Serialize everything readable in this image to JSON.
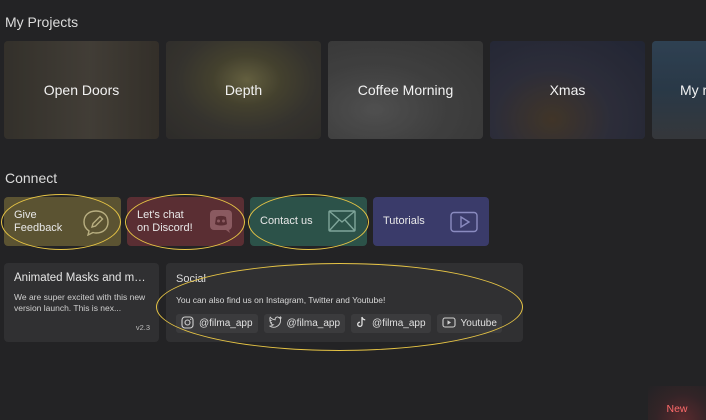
{
  "projects_section": {
    "title": "My Projects",
    "items": [
      {
        "label": "Open Doors"
      },
      {
        "label": "Depth"
      },
      {
        "label": "Coffee Morning"
      },
      {
        "label": "Xmas"
      },
      {
        "label": "My r"
      }
    ]
  },
  "connect_section": {
    "title": "Connect",
    "buttons": [
      {
        "label": "Give\nFeedback",
        "icon": "feedback-pencil-icon",
        "color": "#5b5332"
      },
      {
        "label": "Let's chat\non Discord!",
        "icon": "discord-icon",
        "color": "#5a2e33"
      },
      {
        "label": "Contact us",
        "icon": "mail-icon",
        "color": "#2c5249"
      },
      {
        "label": "Tutorials",
        "icon": "play-icon",
        "color": "#3a3b6a"
      }
    ]
  },
  "news_card": {
    "title": "Animated Masks and muc...",
    "body": "We are super excited with this new version launch. This is nex...",
    "version": "v2.3"
  },
  "social_card": {
    "title": "Social",
    "body": "You can also find us on Instagram, Twitter and Youtube!",
    "links": [
      {
        "icon": "instagram-icon",
        "label": "@filma_app"
      },
      {
        "icon": "twitter-icon",
        "label": "@filma_app"
      },
      {
        "icon": "tiktok-icon",
        "label": "@filma_app"
      },
      {
        "icon": "youtube-icon",
        "label": "Youtube"
      }
    ]
  },
  "badge": {
    "label": "New",
    "color": "#ff6b6b"
  },
  "annotation_color": "#e6c445"
}
